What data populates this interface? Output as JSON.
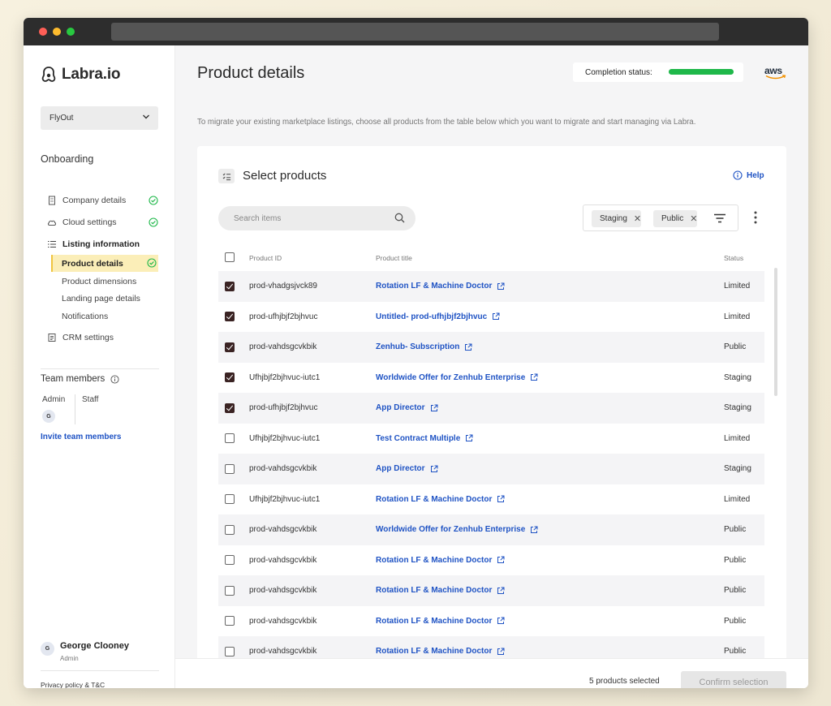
{
  "sidebar": {
    "logo_text": "Labra.io",
    "org_select": "FlyOut",
    "onboarding_title": "Onboarding",
    "nav": [
      {
        "label": "Company details",
        "icon": "building-icon",
        "done": true
      },
      {
        "label": "Cloud settings",
        "icon": "cloud-icon",
        "done": true
      },
      {
        "label": "Listing information",
        "icon": "list-icon",
        "done": false
      },
      {
        "label": "CRM settings",
        "icon": "document-icon",
        "done": false
      }
    ],
    "sub_items": [
      {
        "label": "Product details",
        "active": true,
        "done": true
      },
      {
        "label": "Product dimensions"
      },
      {
        "label": "Landing page details"
      },
      {
        "label": "Notifications"
      }
    ],
    "team_title": "Team members",
    "team_admin": "Admin",
    "team_staff": "Staff",
    "team_avatar": "G",
    "invite": "Invite team members",
    "user": {
      "avatar": "G",
      "name": "George Clooney",
      "role": "Admin"
    },
    "privacy": "Privacy policy & T&C"
  },
  "header": {
    "title": "Product details",
    "completion_label": "Completion status:",
    "completion_progress": 1.0,
    "provider": "aws",
    "intro": "To migrate your existing marketplace listings, choose all products from the table below which you want to migrate and start managing via Labra."
  },
  "card": {
    "title": "Select products",
    "help": "Help",
    "search_placeholder": "Search items",
    "filters": [
      "Staging",
      "Public"
    ],
    "columns": {
      "id": "Product ID",
      "title": "Product title",
      "status": "Status"
    },
    "rows": [
      {
        "id": "prod-vhadgsjvck89",
        "title": "Rotation LF & Machine Doctor",
        "status": "Limited",
        "checked": true
      },
      {
        "id": "prod-ufhjbjf2bjhvuc",
        "title": "Untitled- prod-ufhjbjf2bjhvuc",
        "status": "Limited",
        "checked": true
      },
      {
        "id": "prod-vahdsgcvkbik",
        "title": "Zenhub- Subscription",
        "status": "Public",
        "checked": true
      },
      {
        "id": "Ufhjbjf2bjhvuc-iutc1",
        "title": "Worldwide Offer for Zenhub Enterprise",
        "status": "Staging",
        "checked": true
      },
      {
        "id": "prod-ufhjbjf2bjhvuc",
        "title": "App Director",
        "status": "Staging",
        "checked": true
      },
      {
        "id": "Ufhjbjf2bjhvuc-iutc1",
        "title": "Test Contract Multiple",
        "status": "Limited",
        "checked": false
      },
      {
        "id": "prod-vahdsgcvkbik",
        "title": "App Director",
        "status": "Staging",
        "checked": false
      },
      {
        "id": "Ufhjbjf2bjhvuc-iutc1",
        "title": "Rotation LF & Machine Doctor",
        "status": "Limited",
        "checked": false
      },
      {
        "id": "prod-vahdsgcvkbik",
        "title": "Worldwide Offer for Zenhub Enterprise",
        "status": "Public",
        "checked": false
      },
      {
        "id": "prod-vahdsgcvkbik",
        "title": "Rotation LF & Machine Doctor",
        "status": "Public",
        "checked": false
      },
      {
        "id": "prod-vahdsgcvkbik",
        "title": "Rotation LF & Machine Doctor",
        "status": "Public",
        "checked": false
      },
      {
        "id": "prod-vahdsgcvkbik",
        "title": "Rotation LF & Machine Doctor",
        "status": "Public",
        "checked": false
      },
      {
        "id": "prod-vahdsgcvkbik",
        "title": "Rotation LF & Machine Doctor",
        "status": "Public",
        "checked": false
      }
    ]
  },
  "footer": {
    "selected_count": "5 products selected",
    "confirm": "Confirm selection"
  },
  "colors": {
    "accent_blue": "#1f53c4",
    "active_bg": "#fbeeb8",
    "progress_green": "#1fb84a",
    "checkbox_checked": "#3a2323"
  }
}
